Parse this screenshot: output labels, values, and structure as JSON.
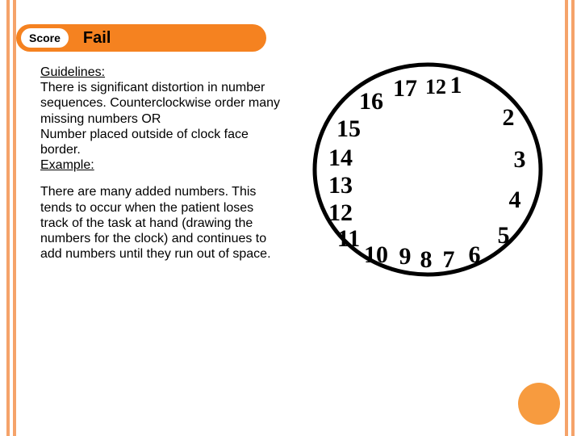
{
  "header": {
    "score_label": "Score",
    "score_result": "Fail"
  },
  "guidelines": {
    "heading": "Guidelines:",
    "body": "There is significant distortion in number sequences. Counterclockwise order many missing numbers OR",
    "body2": "Number placed outside of clock face border.",
    "example_label": "Example:"
  },
  "paragraph": "There are many added numbers. This tends to occur when the patient loses track of the task at hand (drawing the numbers for the clock) and continues to add numbers until they run out of space.",
  "clock": {
    "numbers": [
      "1",
      "2",
      "3",
      "4",
      "5",
      "6",
      "7",
      "8",
      "9",
      "10",
      "11",
      "12",
      "13",
      "14",
      "15",
      "16",
      "17"
    ]
  }
}
